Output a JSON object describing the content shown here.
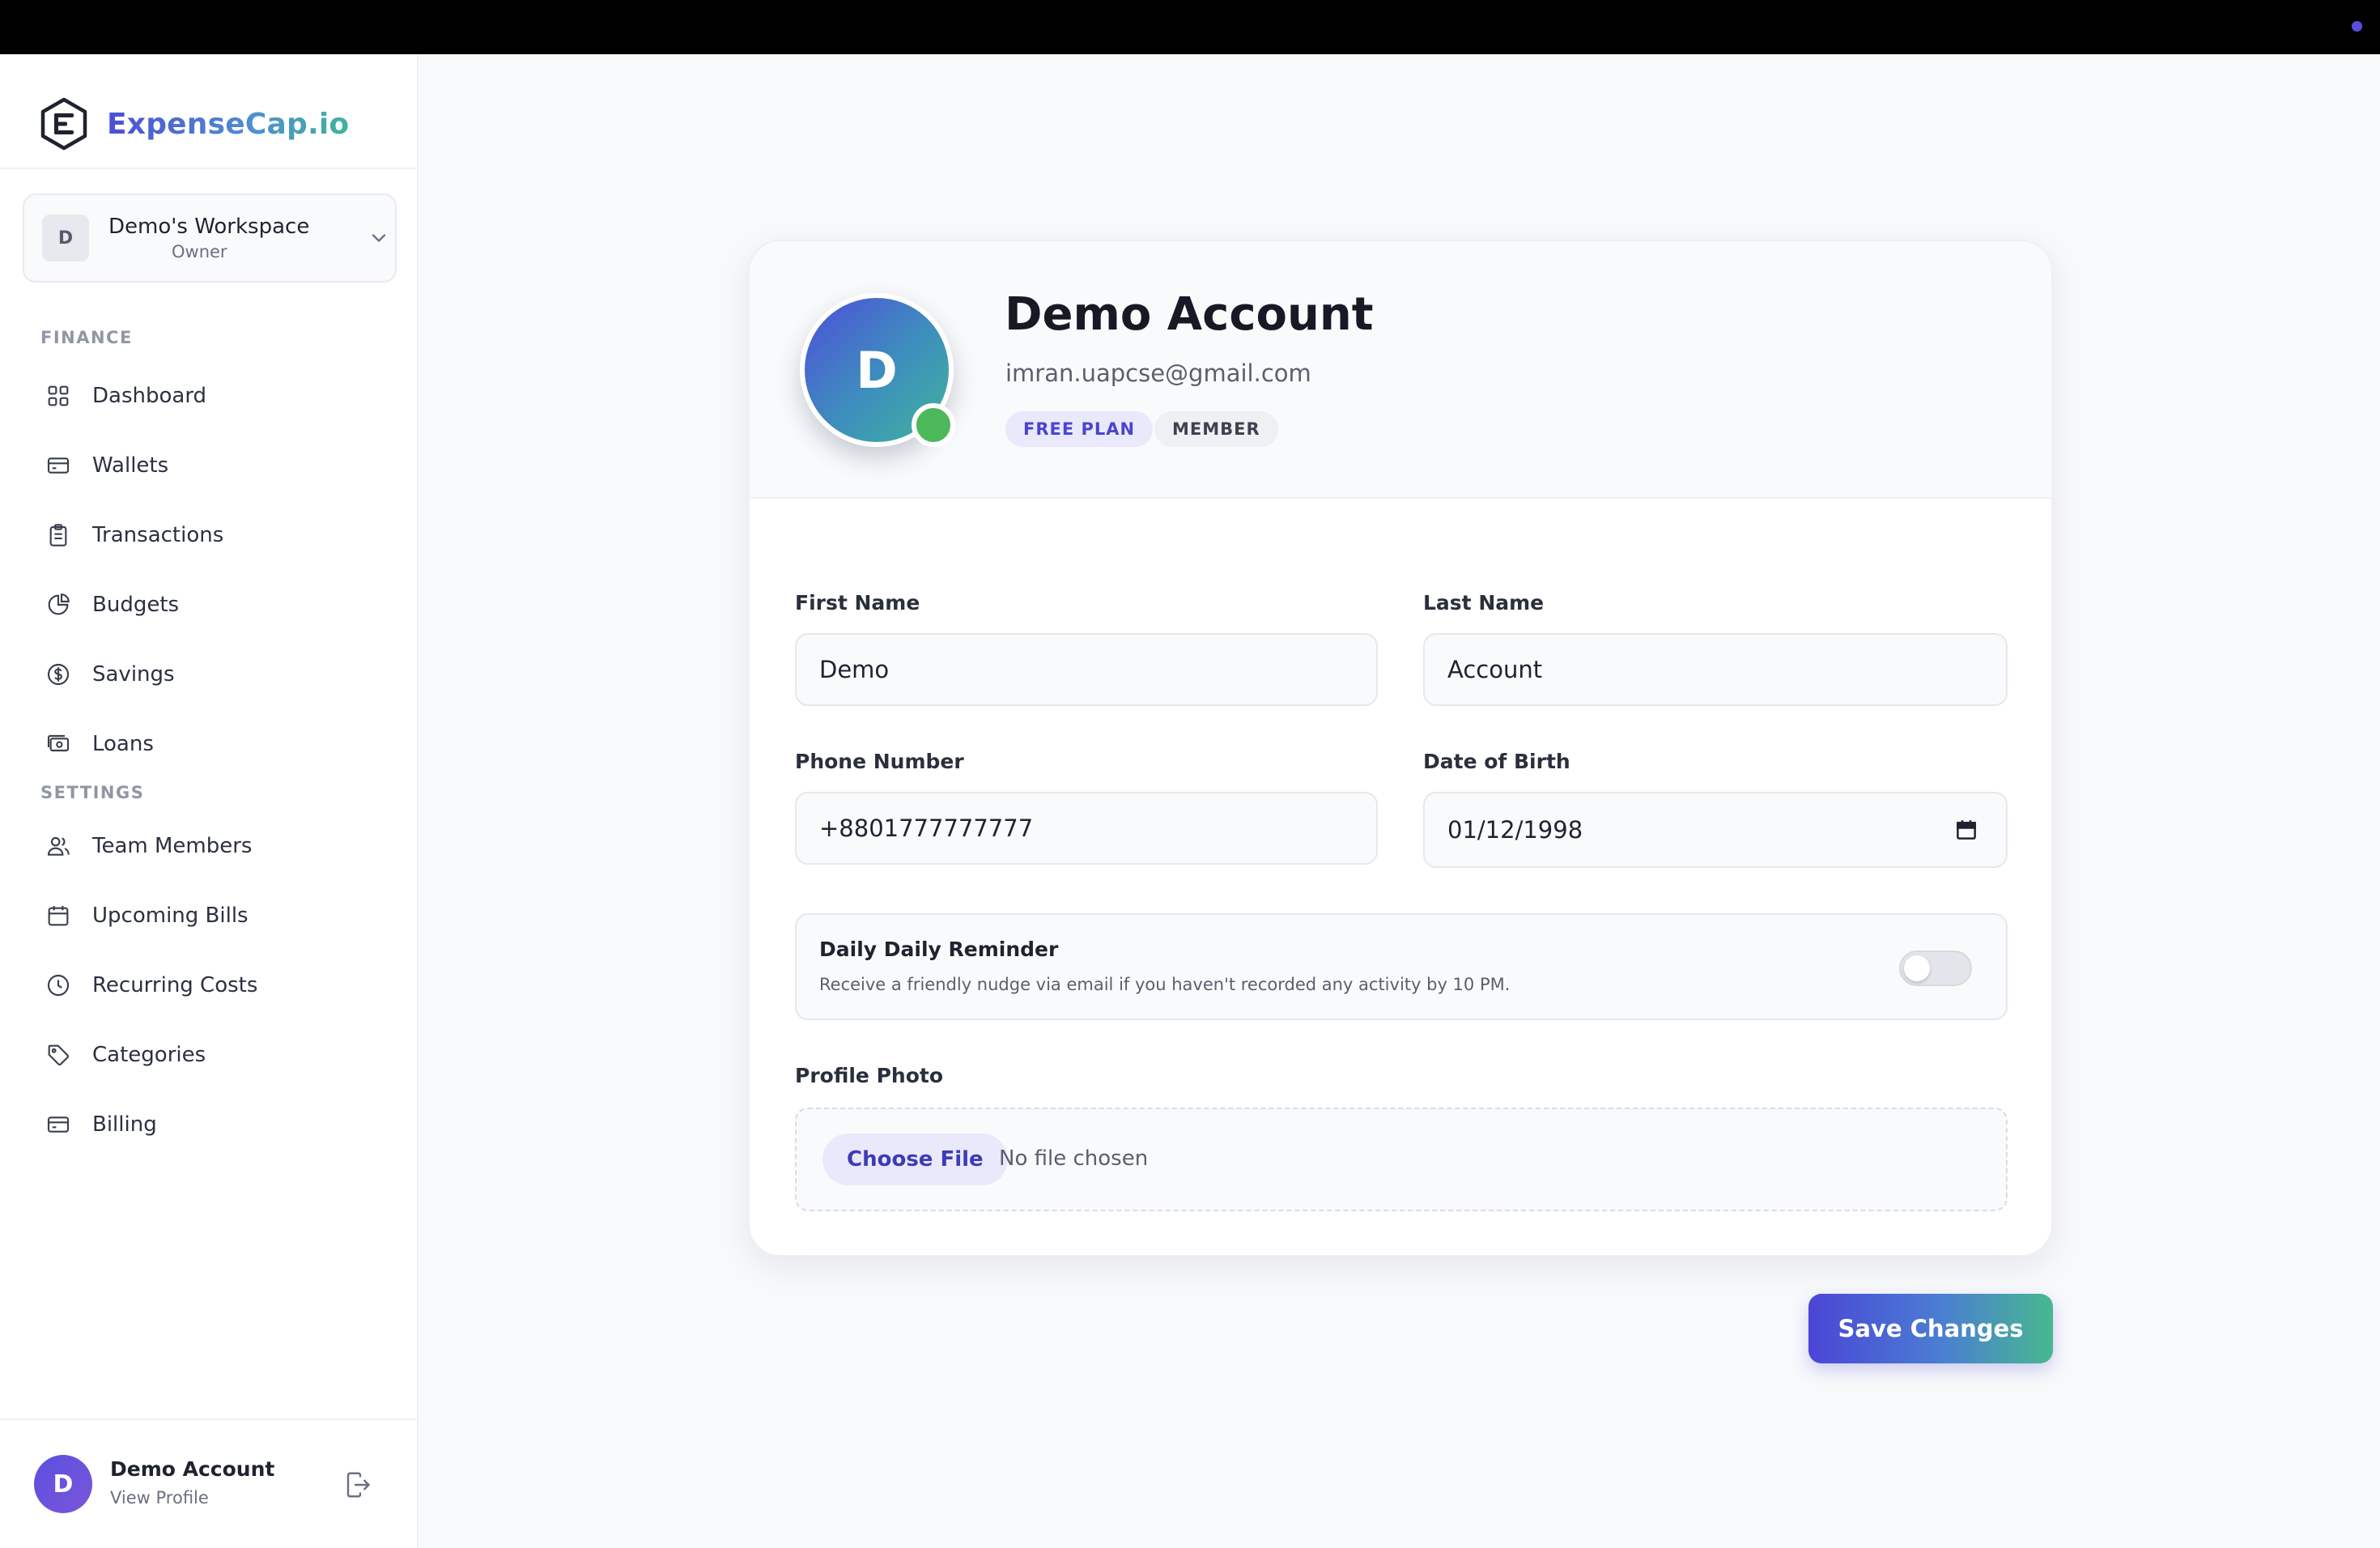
{
  "brand": {
    "name": "ExpenseCap.io"
  },
  "workspace": {
    "initial": "D",
    "name": "Demo's Workspace",
    "role": "Owner"
  },
  "sidebar": {
    "finance_label": "FINANCE",
    "settings_label": "SETTINGS",
    "finance_items": [
      {
        "label": "Dashboard",
        "icon": "grid-icon"
      },
      {
        "label": "Wallets",
        "icon": "wallet-icon"
      },
      {
        "label": "Transactions",
        "icon": "clipboard-icon"
      },
      {
        "label": "Budgets",
        "icon": "pie-chart-icon"
      },
      {
        "label": "Savings",
        "icon": "dollar-circle-icon"
      },
      {
        "label": "Loans",
        "icon": "cash-icon"
      }
    ],
    "settings_items": [
      {
        "label": "Team Members",
        "icon": "users-icon"
      },
      {
        "label": "Upcoming Bills",
        "icon": "calendar-icon"
      },
      {
        "label": "Recurring Costs",
        "icon": "clock-icon"
      },
      {
        "label": "Categories",
        "icon": "tag-icon"
      },
      {
        "label": "Billing",
        "icon": "credit-card-icon"
      }
    ]
  },
  "user": {
    "initial": "D",
    "name": "Demo Account",
    "link": "View Profile"
  },
  "profile": {
    "initial": "D",
    "name": "Demo Account",
    "email": "imran.uapcse@gmail.com",
    "plan_badge": "FREE PLAN",
    "role_badge": "MEMBER"
  },
  "form": {
    "first_name": {
      "label": "First Name",
      "value": "Demo"
    },
    "last_name": {
      "label": "Last Name",
      "value": "Account"
    },
    "phone": {
      "label": "Phone Number",
      "value": "+8801777777777"
    },
    "dob": {
      "label": "Date of Birth",
      "value": "01/12/1998"
    },
    "reminder": {
      "title": "Daily Daily Reminder",
      "description": "Receive a friendly nudge via email if you haven't recorded any activity by 10 PM.",
      "enabled": false
    },
    "photo": {
      "label": "Profile Photo",
      "button": "Choose File",
      "status": "No file chosen"
    }
  },
  "actions": {
    "save": "Save Changes"
  },
  "colors": {
    "accent": "#4b45d6",
    "accent_end": "#47b890",
    "online": "#4cb85c"
  }
}
